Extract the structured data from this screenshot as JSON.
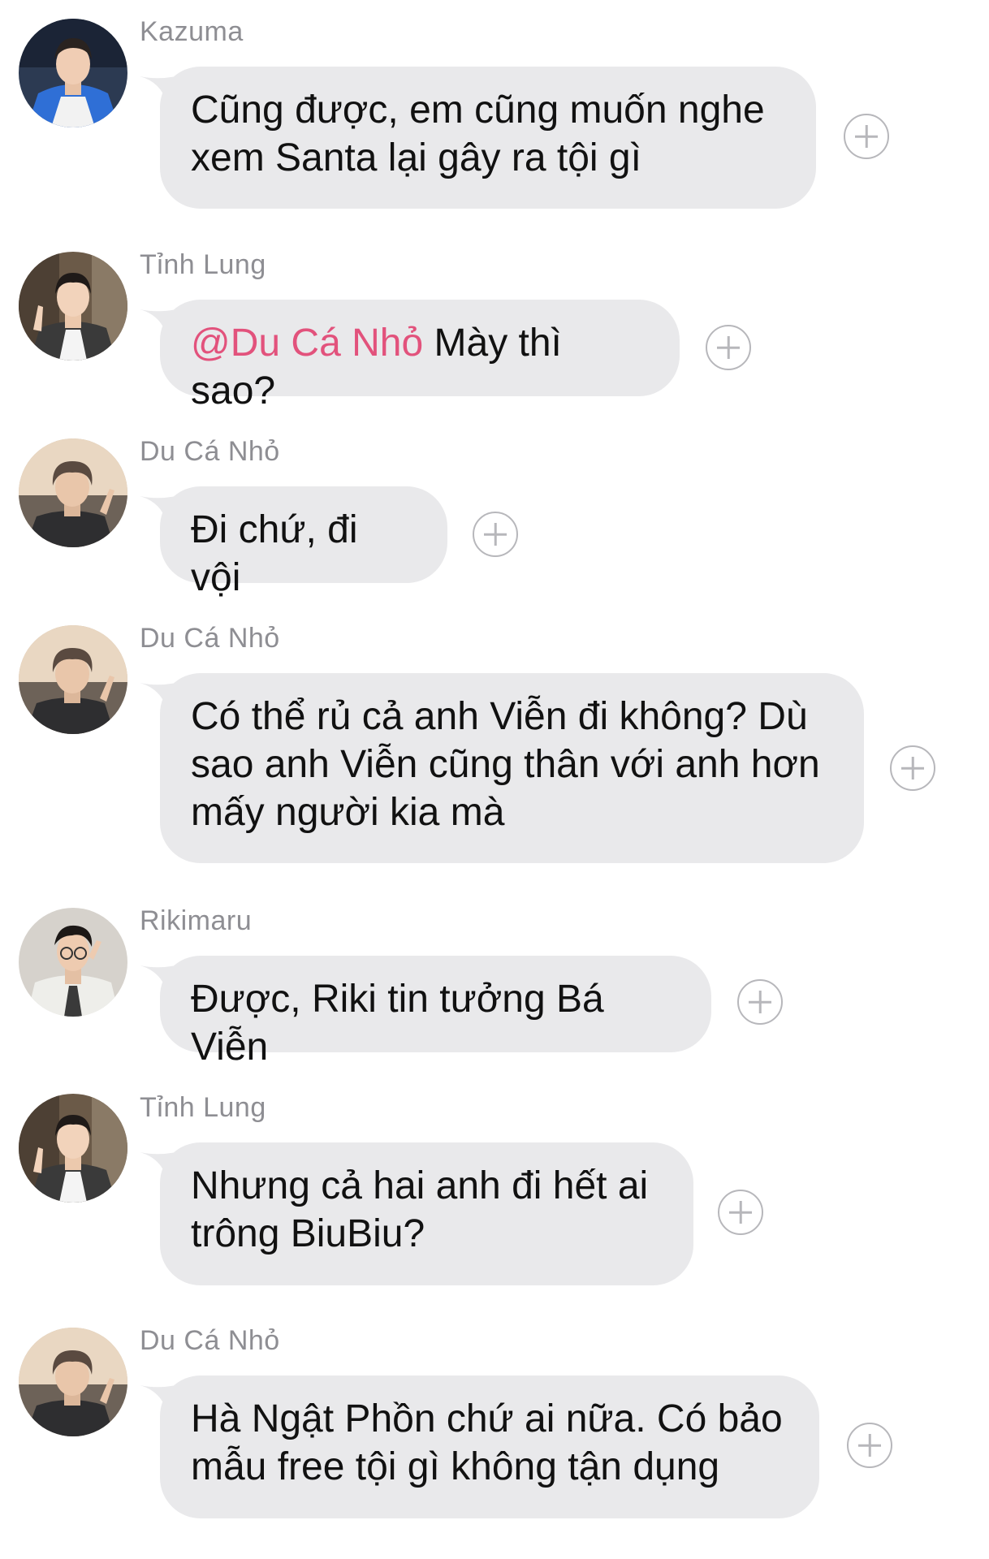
{
  "messages": [
    {
      "sender": "Kazuma",
      "avatar_icon": "kazuma-avatar",
      "text": "Cũng được, em cũng muốn nghe xem Santa lại gây ra tội gì"
    },
    {
      "sender": "Tỉnh Lung",
      "avatar_icon": "tinh-lung-avatar",
      "mention": "@Du Cá Nhỏ",
      "text": " Mày thì sao?"
    },
    {
      "sender": "Du Cá Nhỏ",
      "avatar_icon": "du-ca-nho-avatar",
      "text": "Đi chứ, đi vội"
    },
    {
      "sender": "Du Cá Nhỏ",
      "avatar_icon": "du-ca-nho-avatar",
      "text": "Có thể rủ cả anh Viễn đi không? Dù sao anh Viễn cũng thân với anh hơn mấy người kia mà"
    },
    {
      "sender": "Rikimaru",
      "avatar_icon": "rikimaru-avatar",
      "text": "Được, Riki tin tưởng Bá Viễn"
    },
    {
      "sender": "Tỉnh Lung",
      "avatar_icon": "tinh-lung-avatar",
      "text": "Nhưng cả hai anh đi hết ai trông BiuBiu?"
    },
    {
      "sender": "Du Cá Nhỏ",
      "avatar_icon": "du-ca-nho-avatar",
      "text": "Hà Ngật Phồn chứ ai nữa. Có bảo mẫu free tội gì không tận dụng"
    }
  ],
  "colors": {
    "bubble": "#e9e9eb",
    "mention": "#e2527c",
    "sender": "#8e8e93",
    "text": "#111111"
  }
}
